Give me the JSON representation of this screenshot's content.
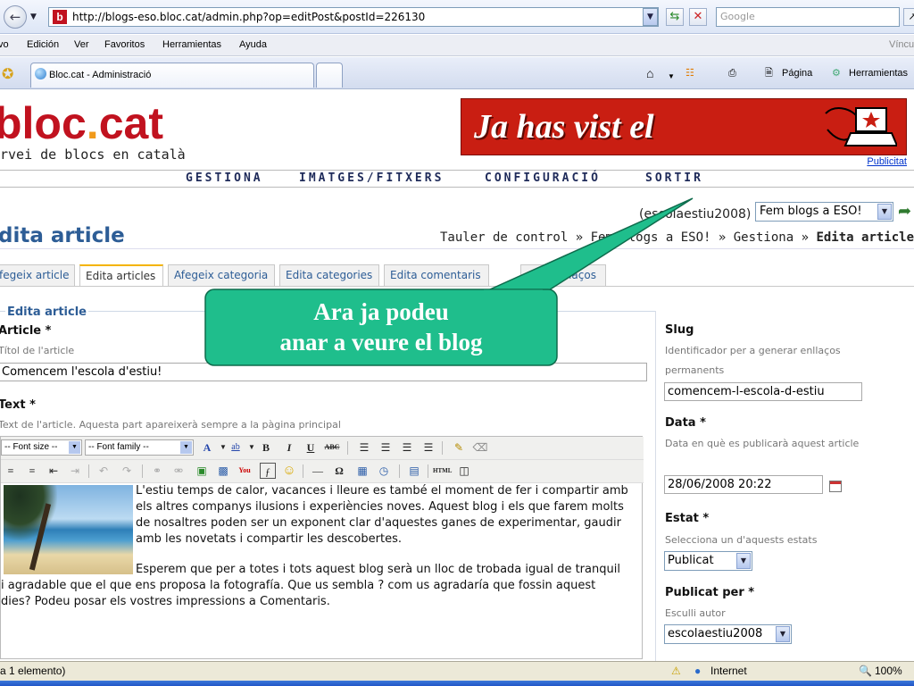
{
  "browser": {
    "url": "http://blogs-eso.bloc.cat/admin.php?op=editPost&postId=226130",
    "favicon_letter": "b",
    "search_placeholder": "Google",
    "menu": [
      "vo",
      "Edición",
      "Ver",
      "Favoritos",
      "Herramientas",
      "Ayuda"
    ],
    "menu_right": "Víncul",
    "tab_title": "Bloc.cat - Administració",
    "pagina_label": "Página",
    "herramientas_label": "Herramientas"
  },
  "site": {
    "logo_main": "bloc",
    "logo_dot": ".",
    "logo_suffix": "cat",
    "tagline": "rvei de blocs en català",
    "banner_text": "Ja has vist el",
    "publicitat": "Publicitat",
    "nav": [
      "GESTIONA",
      "IMATGES/FITXERS",
      "CONFIGURACIÓ",
      "SORTIR"
    ]
  },
  "header": {
    "user": "(escolaestiu2008)",
    "blog_select": "Fem blogs a ESO!",
    "page_title": "dita article",
    "breadcrumb_prefix": "Tauler de control » Fem blogs a ESO! » Gestiona » ",
    "breadcrumb_current": "Edita articles"
  },
  "subtabs": [
    "fegeix article",
    "Edita articles",
    "Afegeix categoria",
    "Edita categories",
    "Edita comentaris",
    "retroenllaços"
  ],
  "form": {
    "legend": "Edita article",
    "article_label": "Article",
    "article_hint": "Títol de l'article",
    "article_value": "Comencem l'escola d'estiu!",
    "text_label": "Text",
    "text_hint": "Text de l'article. Aquesta part apareixerà sempre a la pàgina principal",
    "font_size": "-- Font size --",
    "font_family": "-- Font family --",
    "body_p1": "L'estiu temps de calor, vacances i lleure es també el moment de fer i compartir amb els altres companys ilusions i experiències noves. Aquest blog i els que farem molts de nosaltres poden ser un exponent clar d'aquestes ganes de experimentar, gaudir amb les novetats i compartir les descobertes.",
    "body_p2": "Esperem que per a totes i tots aquest blog serà un lloc de trobada igual de tranquil i agradable que el que ens proposa la fotografía. Que us sembla ? com us agradaría que fossin aquest dies? Podeu posar els vostres impressions a Comentaris."
  },
  "sidebar": {
    "slug_label": "Slug",
    "slug_hint": "Identificador per a generar enllaços permanents",
    "slug_value": "comencem-l-escola-d-estiu",
    "data_label": "Data",
    "data_hint": "Data en què es publicarà aquest article",
    "data_value": "28/06/2008 20:22",
    "estat_label": "Estat",
    "estat_hint": "Selecciona un d'aquests estats",
    "estat_value": "Publicat",
    "autor_label": "Publicat per",
    "autor_hint": "Esculli autor",
    "autor_value": "escolaestiu2008"
  },
  "callout": {
    "line1": "Ara ja podeu",
    "line2": "anar a veure el blog"
  },
  "status": {
    "left": "a 1 elemento)",
    "zone": "Internet",
    "zoom": "100%"
  },
  "colors": {
    "brand_red": "#c1121f",
    "title_blue": "#2d5d96",
    "callout_green": "#1fbe8c"
  }
}
